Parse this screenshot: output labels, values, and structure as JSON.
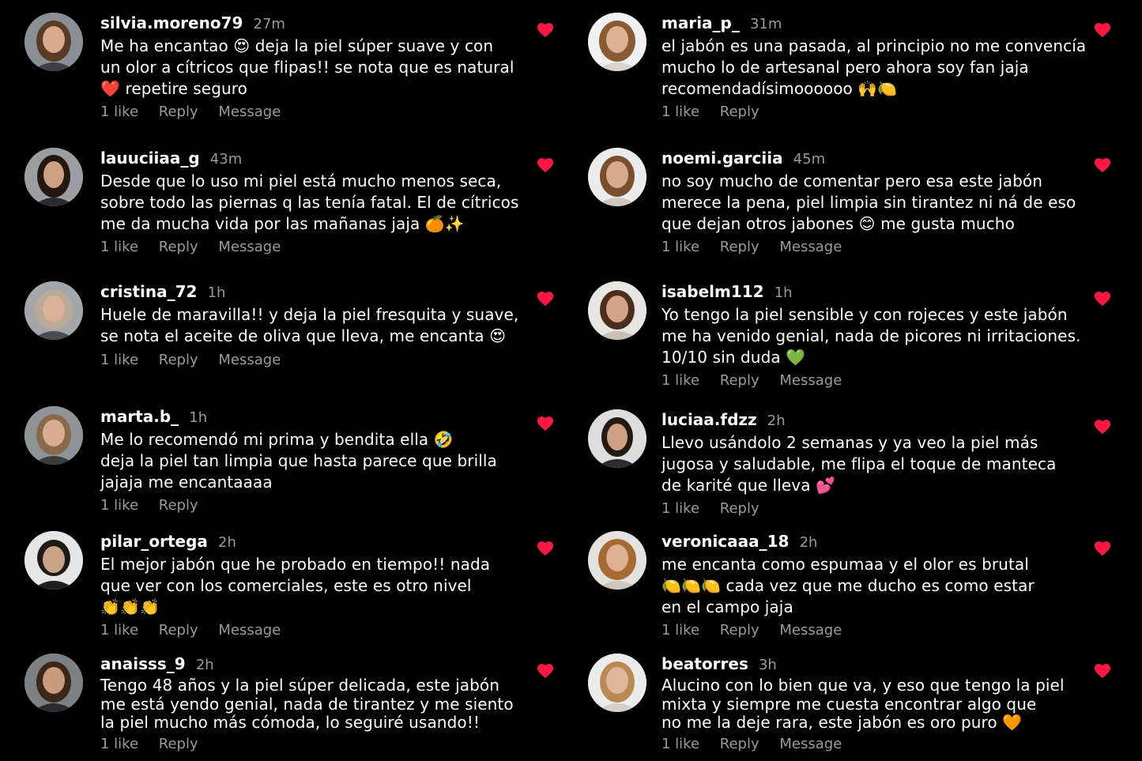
{
  "theme": {
    "background": "#000000",
    "heart_color": "#ff1744",
    "meta_color": "#9a9a9a"
  },
  "comments": [
    {
      "username": "silvia.moreno79",
      "time": "27m",
      "text": "Me ha encantao 😍 deja la piel súper suave y con\nun olor a cítricos que flipas!! se nota que es natural\n❤️ repetire seguro",
      "likes": "1 like",
      "reply": "Reply",
      "message": "Message",
      "liked_icon": "heart-icon"
    },
    {
      "username": "lauuciiaa_g",
      "time": "43m",
      "text": "Desde que lo uso mi piel está mucho menos seca,\nsobre todo las piernas q las tenía fatal. El de cítricos\nme da mucha vida por las mañanas jaja  🍊✨",
      "likes": "1 like",
      "reply": "Reply",
      "message": "Message",
      "liked_icon": "heart-icon"
    },
    {
      "username": "cristina_72",
      "time": "1h",
      "text": "Huele de maravilla!! y deja la piel fresquita y suave,\nse nota el aceite de oliva que lleva, me encanta 😍",
      "likes": "1 like",
      "reply": "Reply",
      "message": "Message",
      "liked_icon": "heart-icon"
    },
    {
      "username": "marta.b_",
      "time": "1h",
      "text": "Me lo recomendó mi prima y bendita ella 🤣\ndeja la piel tan limpia que hasta parece que brilla\njajaja me encantaaaa",
      "likes": "1 like",
      "reply": "Reply",
      "message": "",
      "liked_icon": "heart-icon"
    },
    {
      "username": "pilar_ortega",
      "time": "2h",
      "text": "El mejor jabón que he probado en tiempo!! nada\nque ver con los comerciales, este es otro nivel\n👏👏👏",
      "likes": "1 like",
      "reply": "Reply",
      "message": "Message",
      "liked_icon": "heart-icon"
    },
    {
      "username": "anaisss_9",
      "time": "2h",
      "text": "Tengo 48 años y la piel súper delicada, este jabón\nme está yendo genial, nada de tirantez y me siento\nla piel mucho más cómoda, lo seguiré usando!!",
      "likes": "1 like",
      "reply": "Reply",
      "message": "",
      "liked_icon": "heart-icon"
    },
    {
      "username": "maria_p_",
      "time": "31m",
      "text": "el jabón es una pasada, al principio no me convencía\nmucho lo de artesanal pero ahora soy fan jaja\nrecomendadísimoooooo 🙌🍋",
      "likes": "1 like",
      "reply": "Reply",
      "message": "",
      "liked_icon": "heart-icon"
    },
    {
      "username": "noemi.garciia",
      "time": "45m",
      "text": "no soy mucho de comentar pero esa este jabón\nmerece la pena, piel limpia sin tirantez ni ná de eso\nque dejan otros jabones 😊 me gusta mucho",
      "likes": "1 like",
      "reply": "Reply",
      "message": "Message",
      "liked_icon": "heart-icon"
    },
    {
      "username": "isabelm112",
      "time": "1h",
      "text": "Yo tengo la piel sensible y con rojeces y este jabón\nme ha venido genial, nada de picores ni irritaciones.\n10/10 sin duda 💚",
      "likes": "1 like",
      "reply": "Reply",
      "message": "Message",
      "liked_icon": "heart-icon"
    },
    {
      "username": "luciaa.fdzz",
      "time": "2h",
      "text": "Llevo usándolo 2 semanas y ya veo la piel más\njugosa y saludable, me flipa el toque de manteca\nde karité que lleva 💕",
      "likes": "1 like",
      "reply": "Reply",
      "message": "",
      "liked_icon": "heart-icon"
    },
    {
      "username": "veronicaaa_18",
      "time": "2h",
      "text": "me encanta como espumaa y el olor es brutal\n🍋🍋🍋 cada vez que me ducho es como estar\nen el campo jaja",
      "likes": "1 like",
      "reply": "Reply",
      "message": "Message",
      "liked_icon": "heart-icon"
    },
    {
      "username": "beatorres",
      "time": "3h",
      "text": "Alucino con lo bien que va, y eso que tengo la piel\nmixta y siempre me cuesta encontrar algo que\nno me la deje rara, este jabón es oro puro 🧡",
      "likes": "1 like",
      "reply": "Reply",
      "message": "Message",
      "liked_icon": "heart-icon"
    }
  ]
}
